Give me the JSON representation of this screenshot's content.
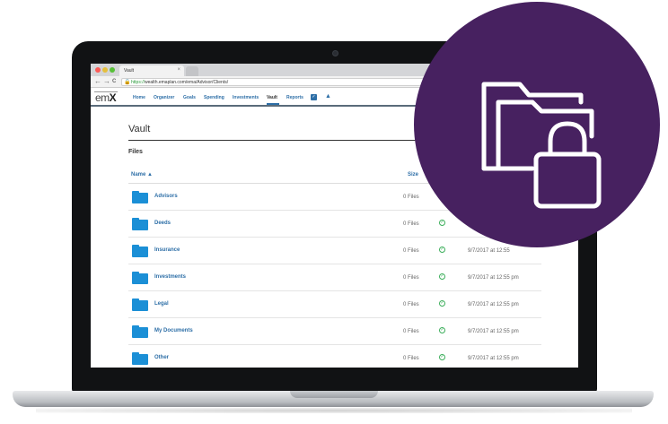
{
  "browser": {
    "tab_title": "Vault",
    "tab_close": "×",
    "url_secure": "https://",
    "url_rest": "wealth.emaplan.com/ema/Advisor/Clients/",
    "nav_back": "←",
    "nav_forward": "→",
    "nav_reload": "C"
  },
  "app": {
    "logo_text_em": "em",
    "logo_text_x": "X",
    "nav": [
      "Home",
      "Organizer",
      "Goals",
      "Spending",
      "Investments",
      "Vault",
      "Reports"
    ],
    "active_nav": "Vault"
  },
  "page": {
    "title": "Vault",
    "section": "Files",
    "columns": {
      "name": "Name ▲",
      "size": "Size"
    },
    "rows": [
      {
        "name": "Advisors",
        "size": "0 Files",
        "synced": false,
        "date": ""
      },
      {
        "name": "Deeds",
        "size": "0 Files",
        "synced": true,
        "date": ""
      },
      {
        "name": "Insurance",
        "size": "0 Files",
        "synced": true,
        "date": "9/7/2017 at 12:55"
      },
      {
        "name": "Investments",
        "size": "0 Files",
        "synced": true,
        "date": "9/7/2017 at 12:55 pm"
      },
      {
        "name": "Legal",
        "size": "0 Files",
        "synced": true,
        "date": "9/7/2017 at 12:55 pm"
      },
      {
        "name": "My Documents",
        "size": "0 Files",
        "synced": true,
        "date": "9/7/2017 at 12:55 pm"
      },
      {
        "name": "Other",
        "size": "0 Files",
        "synced": true,
        "date": "9/7/2017 at 12:55 pm"
      }
    ]
  },
  "colors": {
    "badge": "#472160",
    "link": "#2e6fa7",
    "folder": "#1b8fd6",
    "status": "#3cae5b"
  },
  "icons": {
    "badge_icon": "locked-folder-icon",
    "status_icon": "check-circle-icon",
    "row_icon": "folder-icon"
  }
}
